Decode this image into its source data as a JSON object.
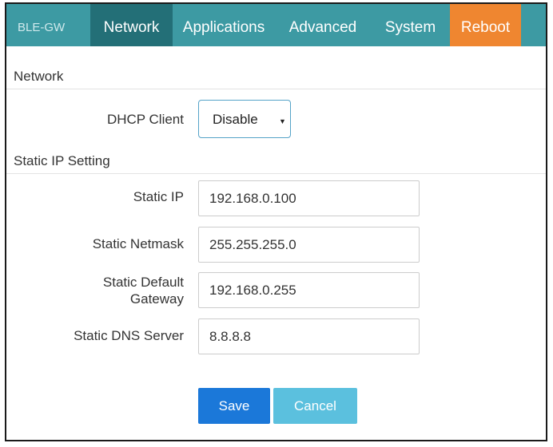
{
  "nav": {
    "brand": "BLE-GW",
    "items": [
      {
        "label": "Network"
      },
      {
        "label": "Applications"
      },
      {
        "label": "Advanced"
      },
      {
        "label": "System"
      },
      {
        "label": "Reboot"
      }
    ],
    "active": "Network",
    "colors": {
      "bar": "#3d9aa3",
      "active": "#236f77",
      "reboot": "#ef8630"
    }
  },
  "network_section": {
    "title": "Network",
    "dhcp": {
      "label": "DHCP Client",
      "value": "Disable"
    }
  },
  "static_section": {
    "title": "Static IP Setting",
    "fields": [
      {
        "label": "Static IP",
        "value": "192.168.0.100"
      },
      {
        "label": "Static Netmask",
        "value": "255.255.255.0"
      },
      {
        "label_line1": "Static Default",
        "label_line2": "Gateway",
        "value": "192.168.0.255"
      },
      {
        "label": "Static DNS Server",
        "value": "8.8.8.8"
      }
    ]
  },
  "buttons": {
    "save": "Save",
    "cancel": "Cancel",
    "colors": {
      "save": "#1b78d9",
      "cancel": "#5bc0de"
    }
  }
}
